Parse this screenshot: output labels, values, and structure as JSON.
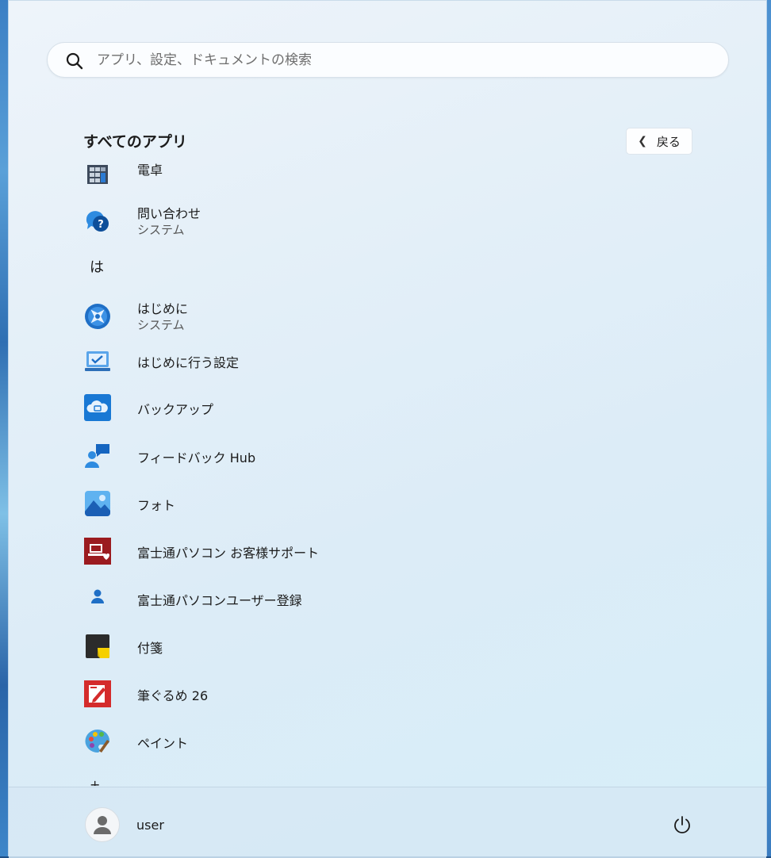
{
  "search": {
    "placeholder": "アプリ、設定、ドキュメントの検索"
  },
  "all_apps": {
    "title": "すべてのアプリ",
    "back_label": "戻る"
  },
  "apps": [
    {
      "name": "電卓",
      "icon": "calculator-icon"
    },
    {
      "name": "問い合わせ",
      "sub": "システム",
      "icon": "get-help-icon"
    },
    {
      "letter": "は"
    },
    {
      "name": "はじめに",
      "sub": "システム",
      "icon": "get-started-icon"
    },
    {
      "name": "はじめに行う設定",
      "icon": "setup-pc-icon"
    },
    {
      "name": "バックアップ",
      "icon": "backup-cloud-icon"
    },
    {
      "name": "フィードバック Hub",
      "icon": "feedback-hub-icon"
    },
    {
      "name": "フォト",
      "icon": "photos-icon"
    },
    {
      "name": "富士通パソコン お客様サポート",
      "icon": "fujitsu-support-icon"
    },
    {
      "name": "富士通パソコンユーザー登録",
      "icon": "user-registration-icon"
    },
    {
      "name": "付箋",
      "icon": "sticky-notes-icon"
    },
    {
      "name": "筆ぐるめ 26",
      "icon": "fudegurume-icon"
    },
    {
      "name": "ペイント",
      "icon": "paint-palette-icon"
    }
  ],
  "user": {
    "name": "user"
  },
  "colors": {
    "accent": "#0a62c2",
    "fujitsu_red": "#9b1b1f",
    "panel_bg": "#e3eff8"
  }
}
